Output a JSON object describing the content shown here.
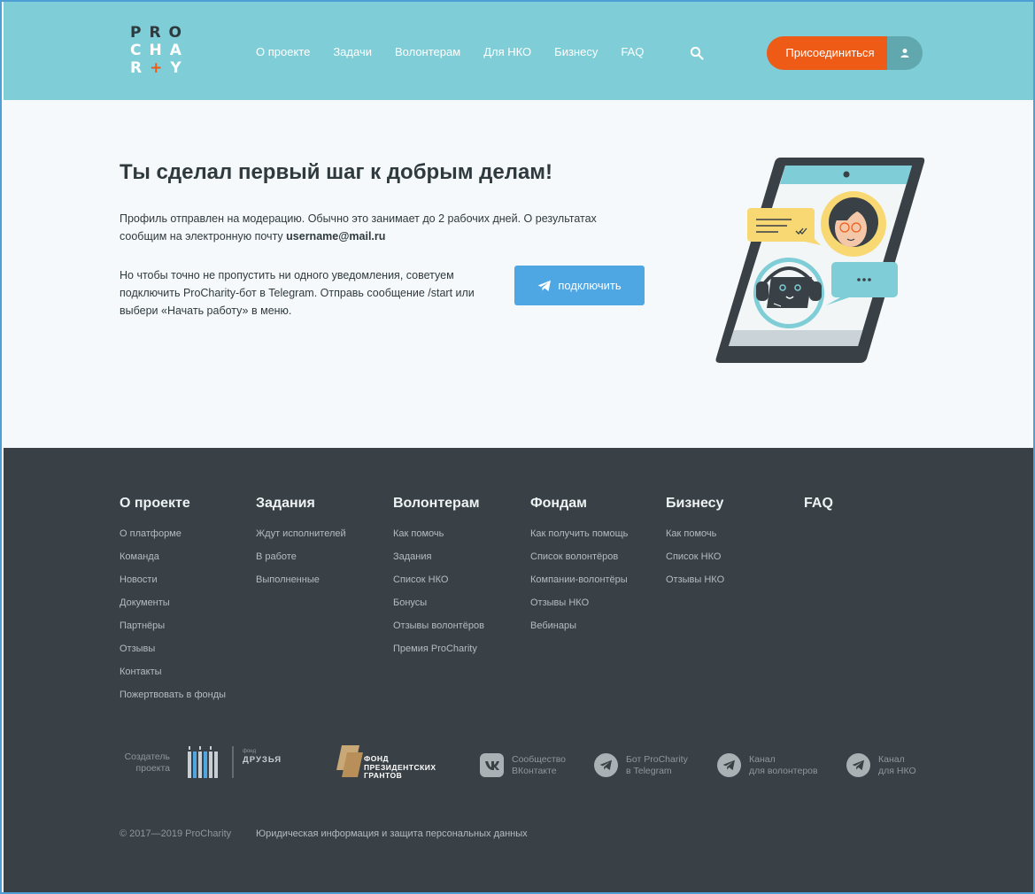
{
  "header": {
    "logo": {
      "line1": "PRO",
      "line2": "CHA",
      "line3_a": "R",
      "line3_cross": "+",
      "line3_b": "Y"
    },
    "nav": [
      "О проекте",
      "Задачи",
      "Волонтерам",
      "Для НКО",
      "Бизнесу",
      "FAQ"
    ],
    "join_label": "Присоединиться",
    "colors": {
      "header_bg": "#7ecdd7",
      "accent": "#ee5b16"
    }
  },
  "main": {
    "title": "Ты сделал первый шаг к добрым делам!",
    "paragraph1_text": "Профиль отправлен на модерацию. Обычно это занимает до 2 рабочих дней. О результатах сообщим на электронную почту ",
    "email": "username@mail.ru",
    "paragraph2": "Но чтобы точно не пропустить ни одного уведомления, советуем подключить ProCharity-бот в Telegram. Отправь сообщение /start или выбери «Начать работу» в меню.",
    "connect_label": "подключить",
    "bubble_dots": "•••"
  },
  "footer": {
    "columns": [
      {
        "title": "О проекте",
        "links": [
          "О платформе",
          "Команда",
          "Новости",
          "Документы",
          "Партнёры",
          "Отзывы",
          "Контакты",
          "Пожертвовать в фонды"
        ]
      },
      {
        "title": "Задания",
        "links": [
          "Ждут исполнителей",
          "В работе",
          "Выполненные"
        ]
      },
      {
        "title": "Волонтерам",
        "links": [
          "Как помочь",
          "Задания",
          "Список НКО",
          "Бонусы",
          "Отзывы волонтёров",
          "Премия ProCharity"
        ]
      },
      {
        "title": "Фондам",
        "links": [
          "Как получить помощь",
          "Список волонтёров",
          "Компании-волонтёры",
          "Отзывы НКО",
          "Вебинары"
        ]
      },
      {
        "title": "Бизнесу",
        "links": [
          "Как помочь",
          "Список НКО",
          "Отзывы НКО"
        ]
      },
      {
        "title": "FAQ",
        "links": []
      }
    ],
    "creator_label": "Создатель проекта",
    "druzya_small": "фонд",
    "druzya_name": "ДРУЗЬЯ",
    "fpg_line1": "ФОНД",
    "fpg_line2": "ПРЕЗИДЕНТСКИХ",
    "fpg_line3": "ГРАНТОВ",
    "social": [
      {
        "icon": "vk-icon",
        "line1": "Сообщество",
        "line2": "ВКонтакте"
      },
      {
        "icon": "telegram-icon",
        "line1": "Бот ProCharity",
        "line2": "в Telegram"
      },
      {
        "icon": "telegram-icon",
        "line1": "Канал",
        "line2": "для волонтеров"
      },
      {
        "icon": "telegram-icon",
        "line1": "Канал",
        "line2": "для НКО"
      }
    ],
    "copyright": "© 2017—2019 ProCharity",
    "legal": "Юридическая информация и защита персональных данных",
    "colors": {
      "footer_bg": "#394147"
    }
  }
}
